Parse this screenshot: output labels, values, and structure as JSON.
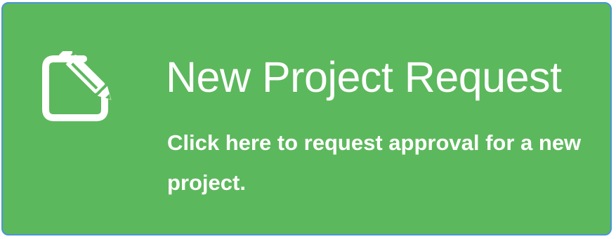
{
  "card": {
    "title": "New Project Request",
    "description": "Click here to request approval for a new project.",
    "icon": "edit-icon",
    "background_color": "#5cb85c",
    "border_color": "#4a94d8",
    "text_color": "#ffffff"
  }
}
